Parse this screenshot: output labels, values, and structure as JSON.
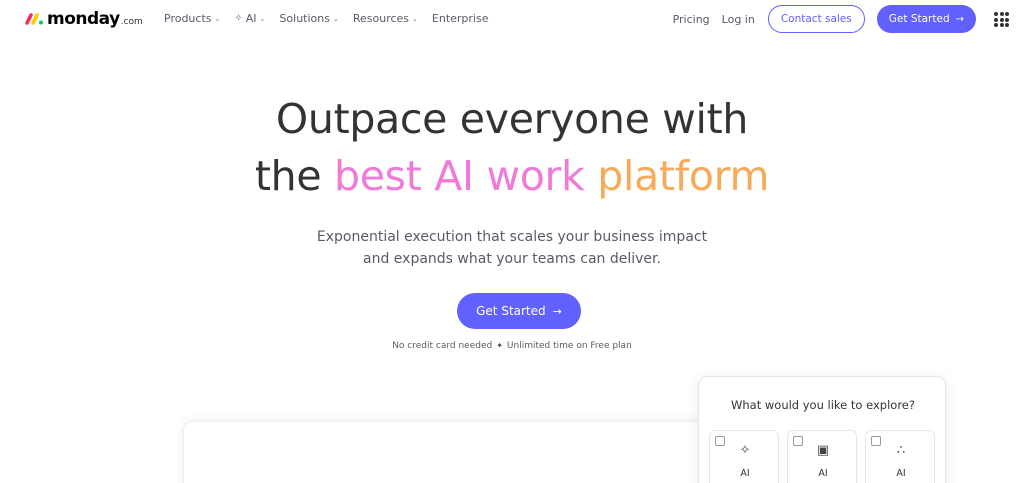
{
  "brand": {
    "name": "monday",
    "suffix": ".com"
  },
  "nav": {
    "items": [
      {
        "label": "Products",
        "has_dropdown": true
      },
      {
        "label": "AI",
        "has_dropdown": true,
        "icon": "sparkle-icon"
      },
      {
        "label": "Solutions",
        "has_dropdown": true
      },
      {
        "label": "Resources",
        "has_dropdown": true
      },
      {
        "label": "Enterprise",
        "has_dropdown": false
      }
    ],
    "pricing": "Pricing",
    "login": "Log in",
    "contact_sales": "Contact sales",
    "get_started": "Get Started"
  },
  "hero": {
    "line1": "Outpace everyone with",
    "line2_prefix": "the",
    "line2_pink": "best AI work",
    "line2_orange": "platform",
    "subtitle_line1": "Exponential execution that scales your business impact",
    "subtitle_line2": "and expands what your teams can deliver.",
    "cta": "Get Started",
    "note_left": "No credit card needed",
    "note_right": "Unlimited time on Free plan"
  },
  "explore": {
    "title": "What would you like to explore?",
    "options": [
      {
        "label": "AI",
        "icon": "sparkle-icon"
      },
      {
        "label": "AI",
        "icon": "ai-builder-icon"
      },
      {
        "label": "AI",
        "icon": "ai-workflow-icon"
      }
    ]
  },
  "colors": {
    "primary": "#6161ff",
    "pink": "#f07ad8",
    "orange": "#f7ab5a",
    "text": "#323338"
  }
}
